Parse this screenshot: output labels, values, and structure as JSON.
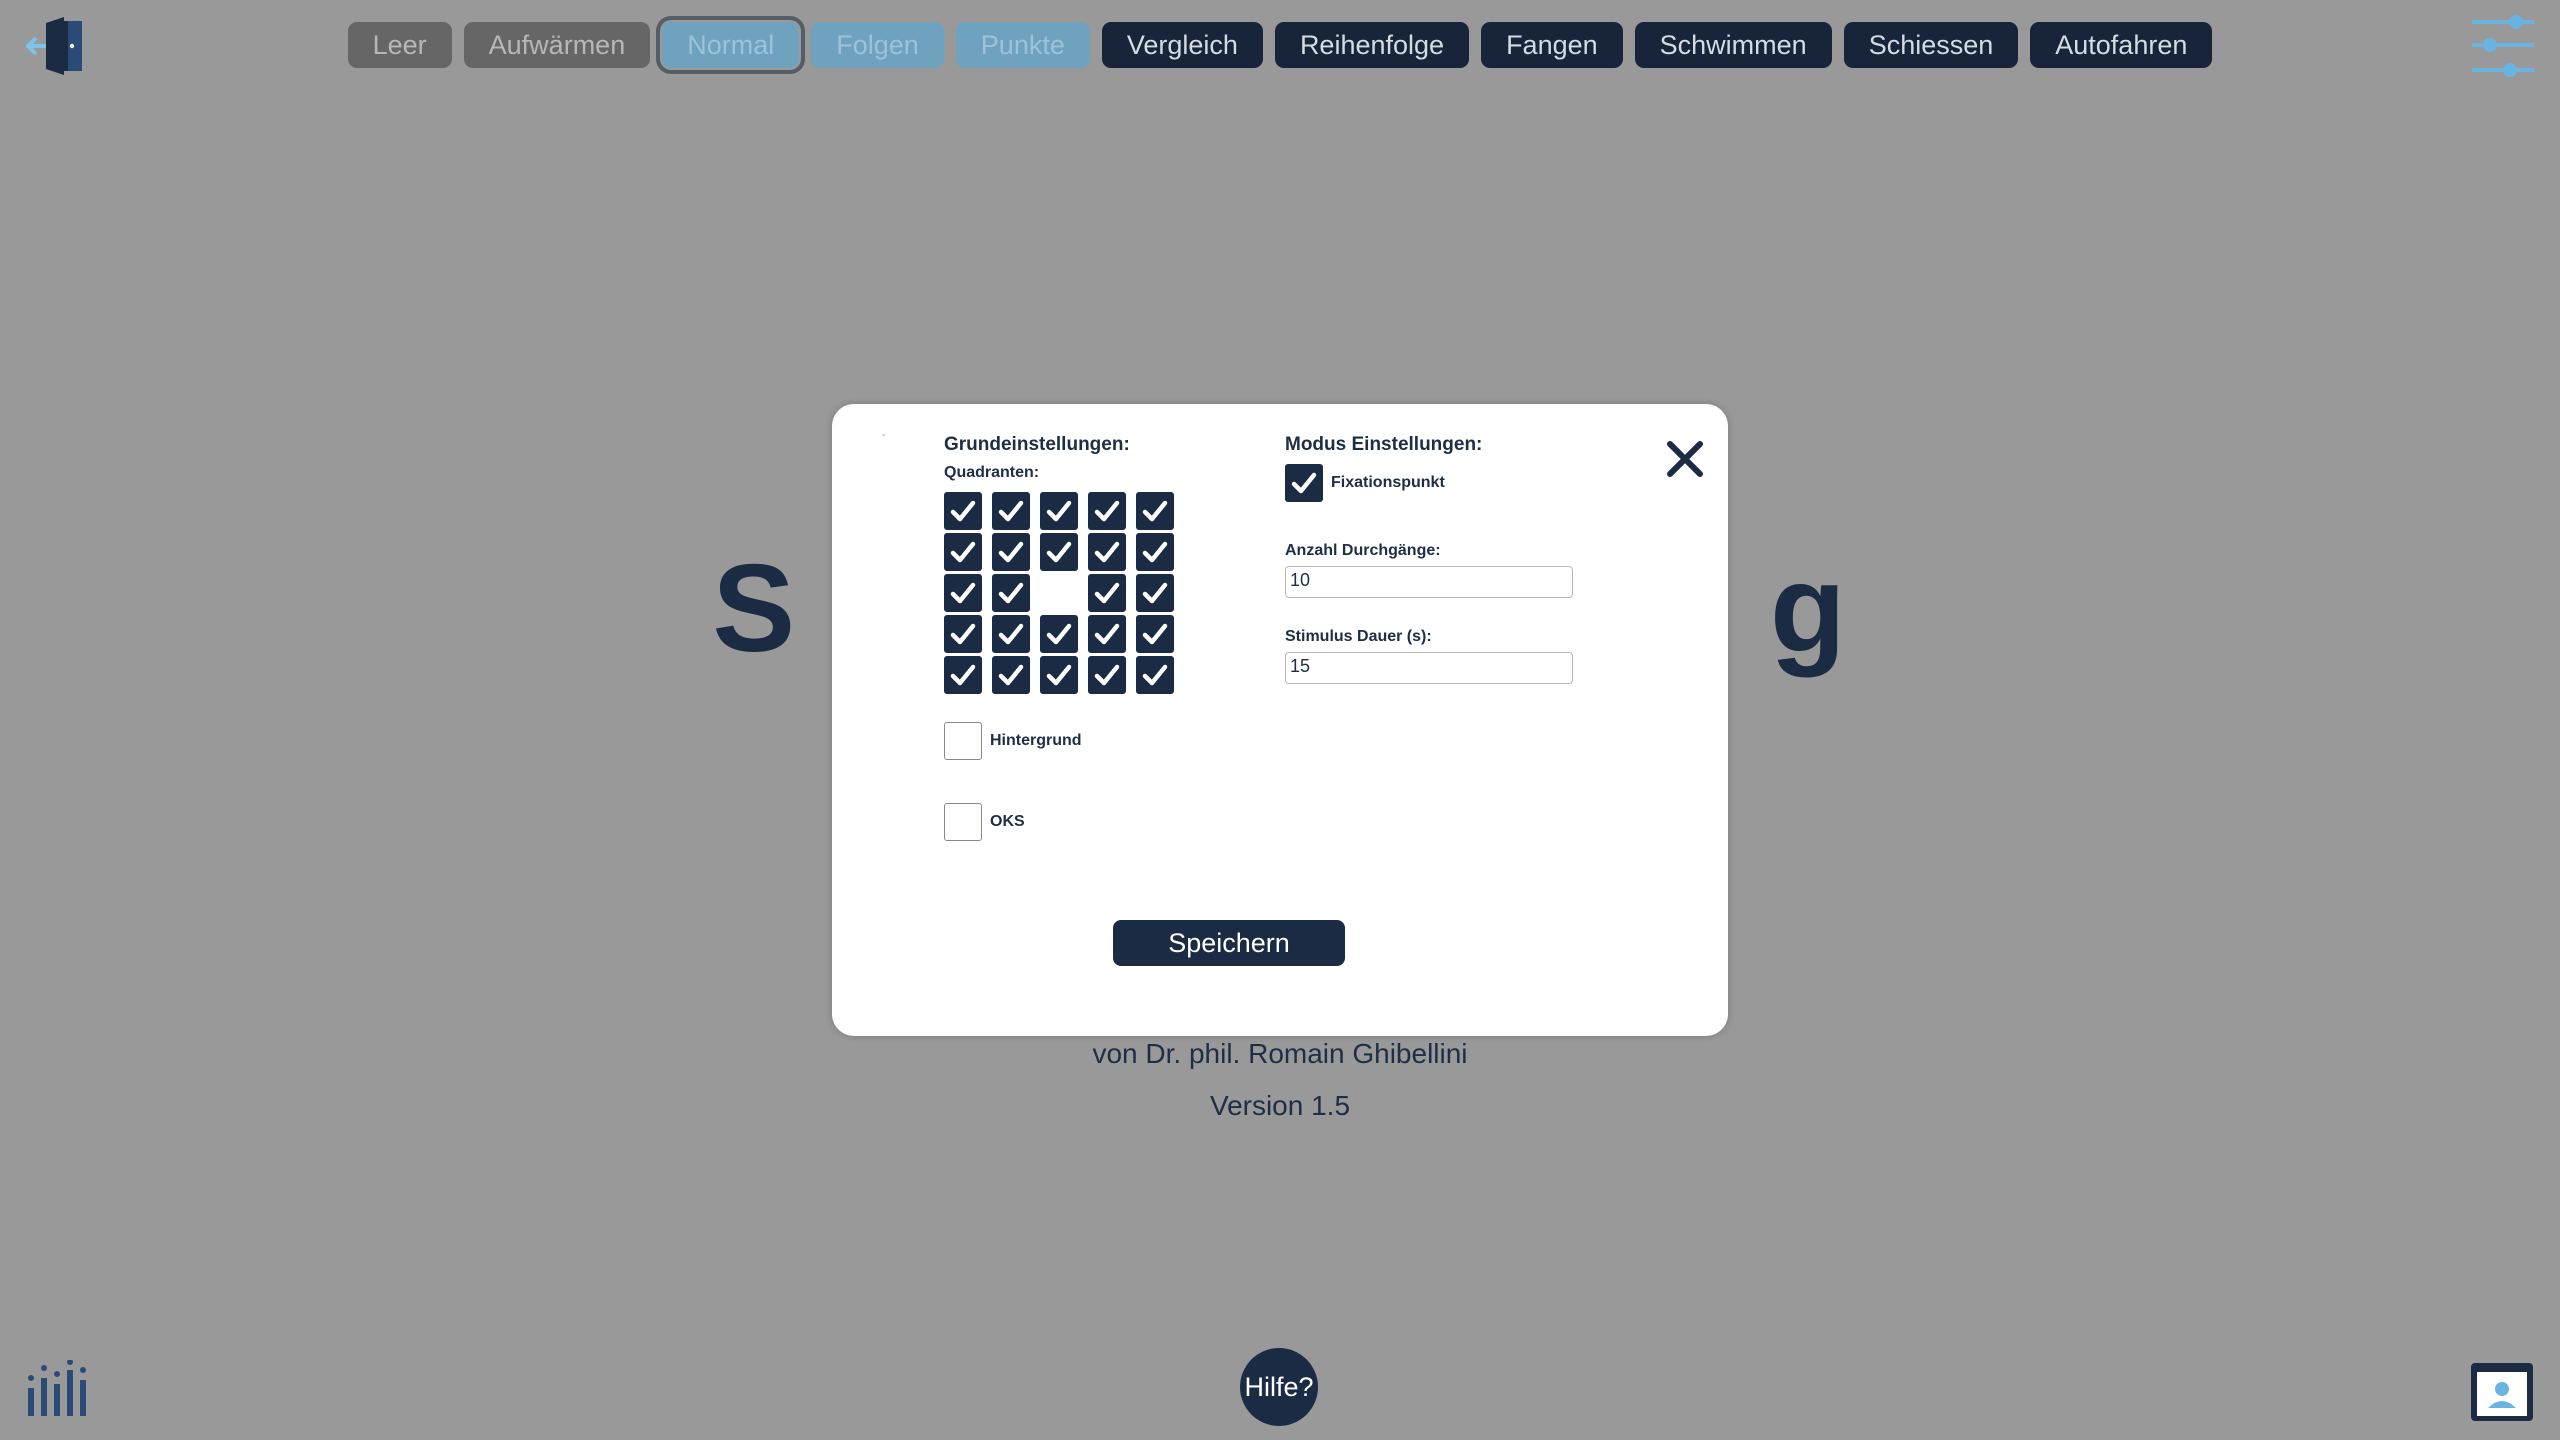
{
  "top_bar": {
    "modes": [
      {
        "label": "Leer",
        "state": "disabled"
      },
      {
        "label": "Aufwärmen",
        "state": "disabled"
      },
      {
        "label": "Normal",
        "state": "selected"
      },
      {
        "label": "Folgen",
        "state": "light"
      },
      {
        "label": "Punkte",
        "state": "light"
      },
      {
        "label": "Vergleich",
        "state": "active"
      },
      {
        "label": "Reihenfolge",
        "state": "active"
      },
      {
        "label": "Fangen",
        "state": "active"
      },
      {
        "label": "Schwimmen",
        "state": "active"
      },
      {
        "label": "Schiessen",
        "state": "active"
      },
      {
        "label": "Autofahren",
        "state": "active"
      }
    ],
    "exit_icon": "exit-door-icon",
    "settings_icon": "sliders-icon"
  },
  "background": {
    "title_start": "S",
    "title_end": "g",
    "author": "von Dr. phil. Romain Ghibellini",
    "version": "Version 1.5"
  },
  "modal": {
    "hint": "-",
    "basic_settings_title": "Grundeinstellungen:",
    "quadrants_label": "Quadranten:",
    "quadrants": [
      [
        true,
        true,
        true,
        true,
        true
      ],
      [
        true,
        true,
        true,
        true,
        true
      ],
      [
        true,
        true,
        null,
        true,
        true
      ],
      [
        true,
        true,
        true,
        true,
        true
      ],
      [
        true,
        true,
        true,
        true,
        true
      ]
    ],
    "background_label": "Hintergrund",
    "background_checked": false,
    "oks_label": "OKS",
    "oks_checked": false,
    "mode_settings_title": "Modus Einstellungen:",
    "fixation_label": "Fixationspunkt",
    "fixation_checked": true,
    "runs_label": "Anzahl Durchgänge:",
    "runs_value": "10",
    "duration_label": "Stimulus Dauer (s):",
    "duration_value": "15",
    "save_label": "Speichern"
  },
  "bottom": {
    "help_label": "Hilfe?",
    "stats_icon": "bar-chart-icon",
    "profile_icon": "profile-card-icon"
  },
  "colors": {
    "dark_navy": "#1b2b44",
    "light_blue": "#6ea2bf",
    "grey_button": "#666666",
    "overlay_grey": "#999999"
  }
}
